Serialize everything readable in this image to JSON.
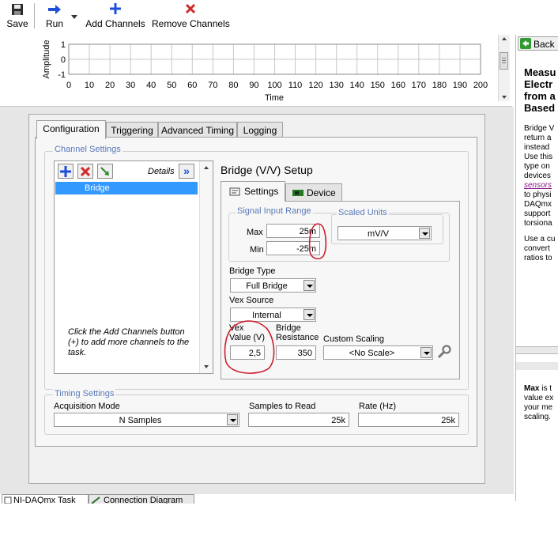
{
  "toolbar": {
    "save": "Save",
    "run": "Run",
    "add_channels": "Add Channels",
    "remove_channels": "Remove Channels"
  },
  "graph": {
    "ylabel": "Amplitude",
    "xlabel": "Time",
    "y_ticks": [
      "1",
      "0",
      "-1"
    ],
    "x_ticks": [
      "0",
      "10",
      "20",
      "30",
      "40",
      "50",
      "60",
      "70",
      "80",
      "90",
      "100",
      "110",
      "120",
      "130",
      "140",
      "150",
      "160",
      "170",
      "180",
      "190",
      "200"
    ]
  },
  "tabs": [
    "Configuration",
    "Triggering",
    "Advanced Timing",
    "Logging"
  ],
  "channel_settings": {
    "title": "Channel Settings",
    "details": "Details",
    "details_btn": "»",
    "channels": [
      "Bridge"
    ],
    "hint": "Click the Add Channels button (+) to add more channels to the task."
  },
  "setup": {
    "title": "Bridge (V/V) Setup",
    "tab_settings": "Settings",
    "tab_device": "Device",
    "signal_input_range": "Signal Input Range",
    "max_label": "Max",
    "max_value": "25m",
    "min_label": "Min",
    "min_value": "-25m",
    "scaled_units_label": "Scaled Units",
    "scaled_units_value": "mV/V",
    "bridge_type_label": "Bridge Type",
    "bridge_type_value": "Full Bridge",
    "vex_source_label": "Vex Source",
    "vex_source_value": "Internal",
    "vex_value_label_1": "Vex",
    "vex_value_label_2": "Value (V)",
    "vex_value": "2,5",
    "bridge_res_label_1": "Bridge",
    "bridge_res_label_2": "Resistance",
    "bridge_res_value": "350",
    "custom_scaling_label": "Custom Scaling",
    "custom_scaling_value": "<No Scale>"
  },
  "timing": {
    "title": "Timing Settings",
    "acq_mode_label": "Acquisition Mode",
    "acq_mode_value": "N Samples",
    "samples_label": "Samples to Read",
    "samples_value": "25k",
    "rate_label": "Rate (Hz)",
    "rate_value": "25k"
  },
  "help": {
    "back": "Back",
    "heading": [
      "Measu",
      "Electr",
      "from a",
      "Based"
    ],
    "para1": [
      "Bridge V",
      "return a",
      "instead",
      "Use this",
      "type on",
      "devices"
    ],
    "link": "sensors",
    "para1b": [
      "to physi",
      "DAQmx",
      "support",
      "torsiona"
    ],
    "para2": [
      "Use a cu",
      "convert",
      "ratios to"
    ],
    "bottom_bold": "Max",
    "bottom": [
      " is t",
      "value ex",
      "your me",
      "scaling."
    ]
  },
  "bottom_tabs": [
    "NI-DAQmx Task",
    "Connection Diagram"
  ],
  "colors": {
    "accent_blue": "#3a8ee6",
    "group_title": "#5a79b8",
    "annotation_red": "#cc1f2e",
    "selection": "#3399ff",
    "link": "#8b1a8b"
  }
}
